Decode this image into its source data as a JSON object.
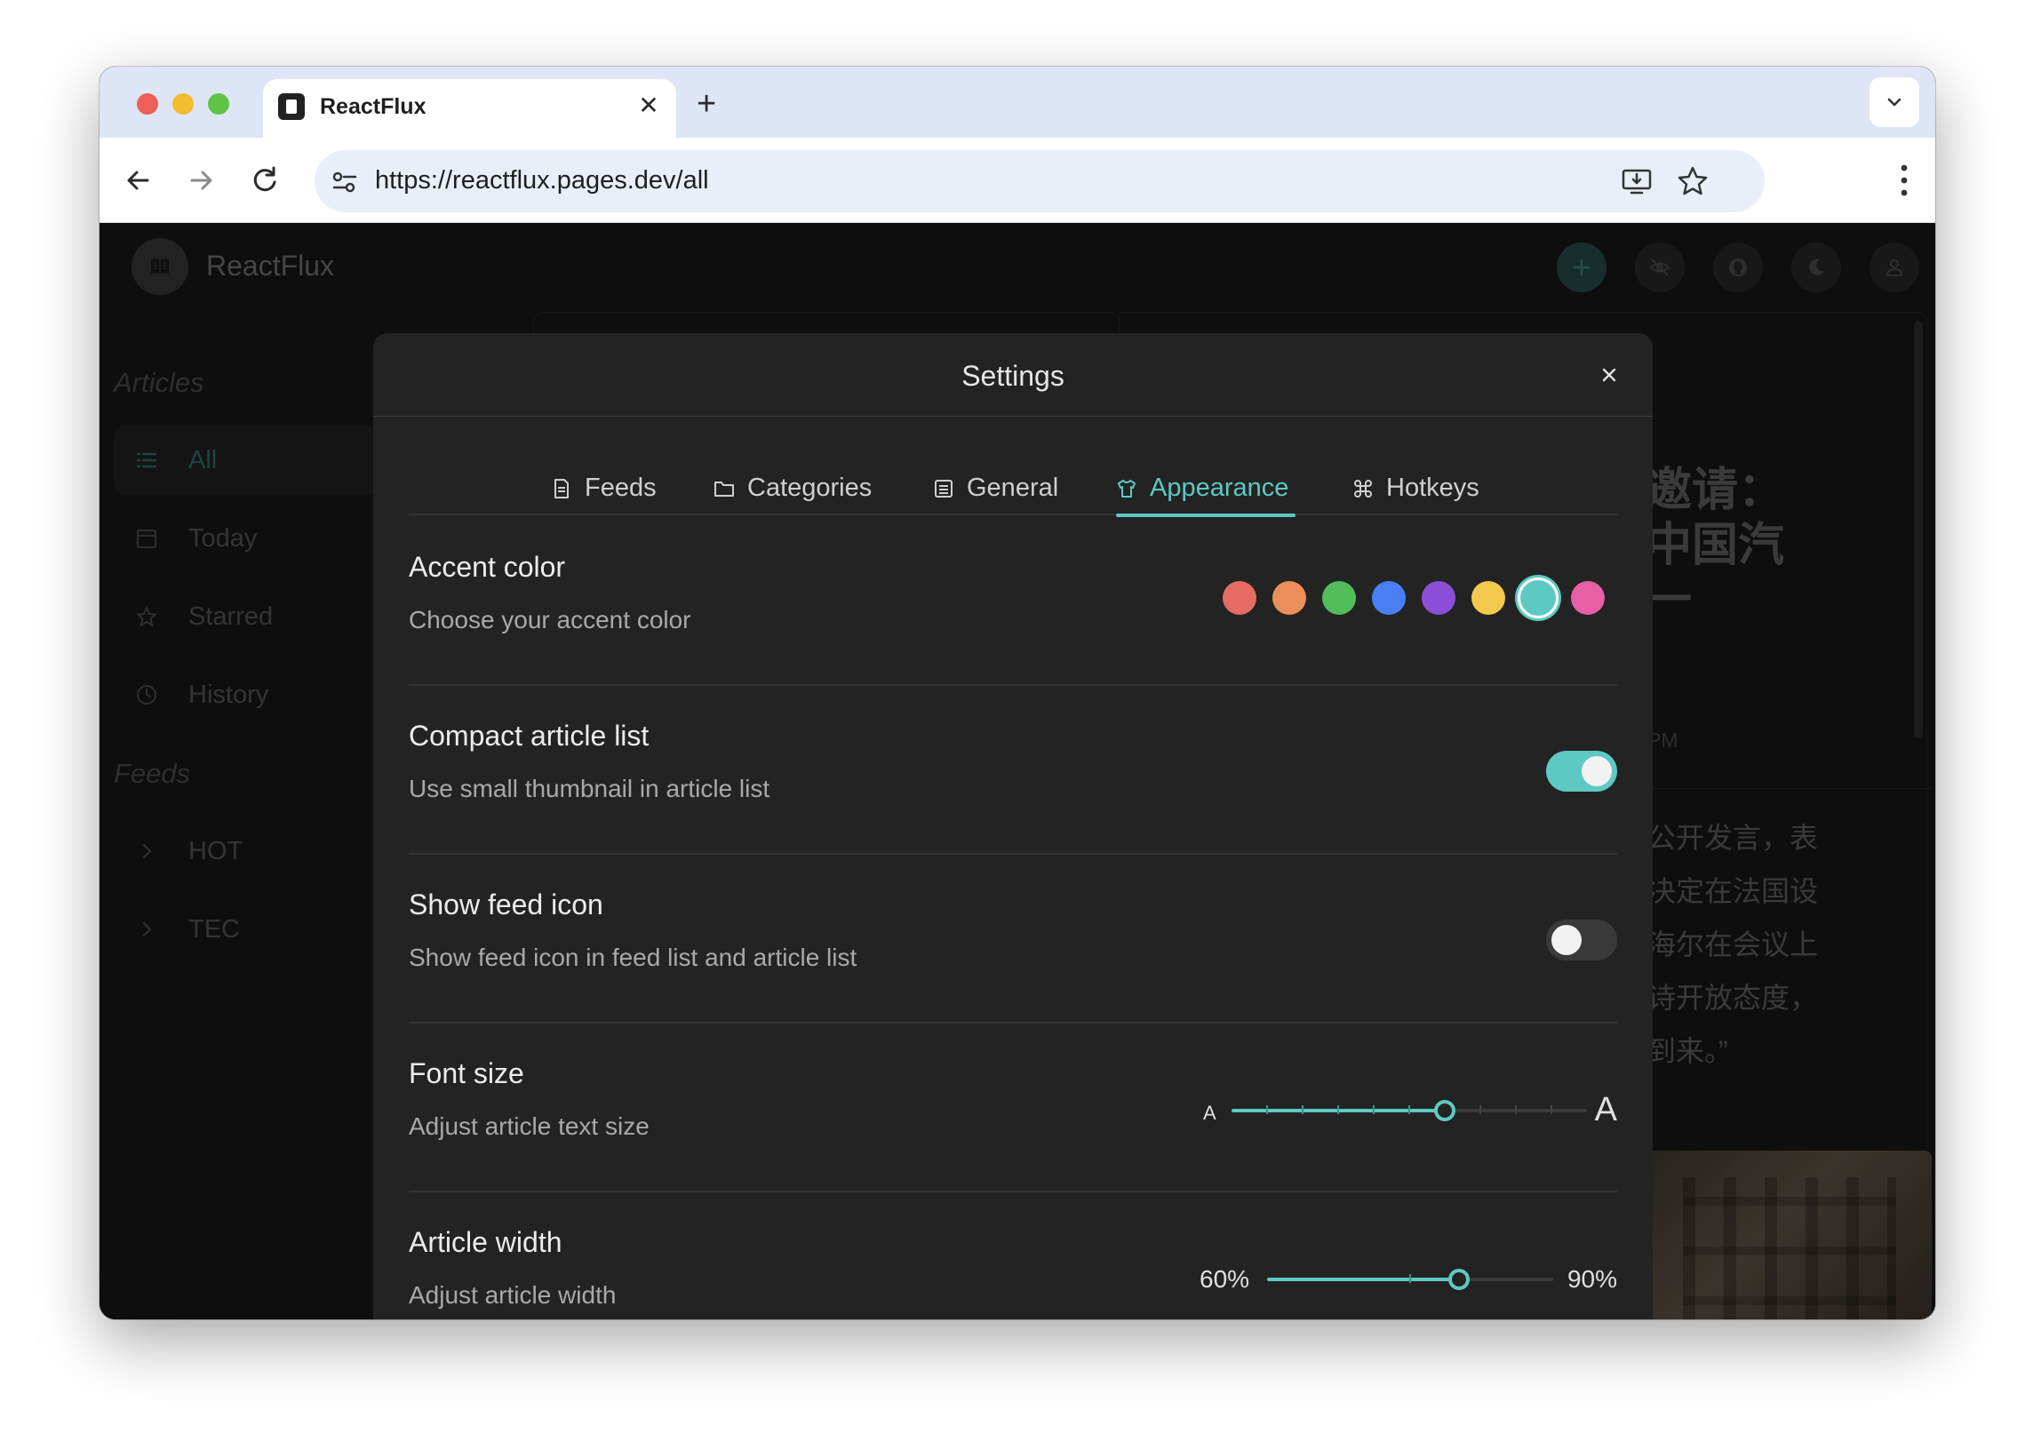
{
  "browser": {
    "tab_title": "ReactFlux",
    "tab_close": "✕",
    "new_tab": "+",
    "url": "https://reactflux.pages.dev/all"
  },
  "app": {
    "name": "ReactFlux",
    "header_buttons": [
      {
        "name": "add-feed",
        "icon": "plus-icon"
      },
      {
        "name": "hide-read",
        "icon": "eye-off-icon"
      },
      {
        "name": "github",
        "icon": "github-icon"
      },
      {
        "name": "theme",
        "icon": "moon-icon"
      },
      {
        "name": "profile",
        "icon": "user-icon"
      }
    ]
  },
  "sidebar": {
    "articles_heading": "Articles",
    "items": [
      {
        "label": "All",
        "icon": "list-icon",
        "active": true
      },
      {
        "label": "Today",
        "icon": "calendar-icon"
      },
      {
        "label": "Starred",
        "icon": "star-icon"
      },
      {
        "label": "History",
        "icon": "history-icon"
      }
    ],
    "feeds_heading": "Feeds",
    "feeds": [
      {
        "label": "HOT",
        "icon": "chevron-right-icon"
      },
      {
        "label": "TEC",
        "icon": "chevron-right-icon"
      }
    ]
  },
  "background_article": {
    "title_lines": [
      "邀请：",
      "中国汽",
      "一"
    ],
    "time": "PM",
    "paragraph_lines": [
      "公开发言，表",
      "决定在法国设",
      "海尔在会议上",
      "诗开放态度，",
      "到来。”"
    ]
  },
  "settings": {
    "title": "Settings",
    "tabs": [
      {
        "label": "Feeds",
        "icon": "file-icon"
      },
      {
        "label": "Categories",
        "icon": "folder-icon"
      },
      {
        "label": "General",
        "icon": "list-box-icon"
      },
      {
        "label": "Appearance",
        "icon": "shirt-icon",
        "active": true
      },
      {
        "label": "Hotkeys",
        "icon": "command-icon"
      }
    ],
    "accent": {
      "title": "Accent color",
      "description": "Choose your accent color",
      "colors": [
        "#e66c63",
        "#ea8f5c",
        "#52bd5a",
        "#4a7ff3",
        "#8a4fd6",
        "#f2c94c",
        "#5ec9c2",
        "#e75fa6"
      ],
      "selected": "#5ec9c2"
    },
    "compact": {
      "title": "Compact article list",
      "description": "Use small thumbnail in article list",
      "enabled": true
    },
    "feed_icon": {
      "title": "Show feed icon",
      "description": "Show feed icon in feed list and article list",
      "enabled": false
    },
    "font_size": {
      "title": "Font size",
      "description": "Adjust article text size",
      "min_label": "A",
      "max_label": "A",
      "value": 0.6
    },
    "article_width": {
      "title": "Article width",
      "description": "Adjust article width",
      "min_label": "60%",
      "max_label": "90%",
      "value": 0.67
    }
  }
}
